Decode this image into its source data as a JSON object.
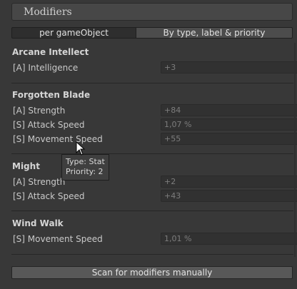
{
  "header": {
    "title": "Modifiers"
  },
  "tabs": [
    {
      "label": "per gameObject",
      "active": true
    },
    {
      "label": "By type, label & priority",
      "active": false
    }
  ],
  "groups": [
    {
      "title": "Arcane Intellect",
      "rows": [
        {
          "label": "[A] Intelligence",
          "value": "+3"
        }
      ]
    },
    {
      "title": "Forgotten Blade",
      "rows": [
        {
          "label": "[A] Strength",
          "value": "+84"
        },
        {
          "label": "[S] Attack Speed",
          "value": "1,07 %"
        },
        {
          "label": "[S] Movement Speed",
          "value": "+55"
        }
      ]
    },
    {
      "title": "Might",
      "rows": [
        {
          "label": "[A] Strength",
          "value": "+2"
        },
        {
          "label": "[S] Attack Speed",
          "value": "+43"
        }
      ]
    },
    {
      "title": "Wind Walk",
      "rows": [
        {
          "label": "[S] Movement Speed",
          "value": "1,01 %"
        }
      ]
    }
  ],
  "tooltip": {
    "line1": "Type: Stat",
    "line2": "Priority: 2"
  },
  "scan_button": {
    "label": "Scan for modifiers manually"
  },
  "colors": {
    "background": "#383838",
    "field": "#313131",
    "button": "#585858"
  }
}
